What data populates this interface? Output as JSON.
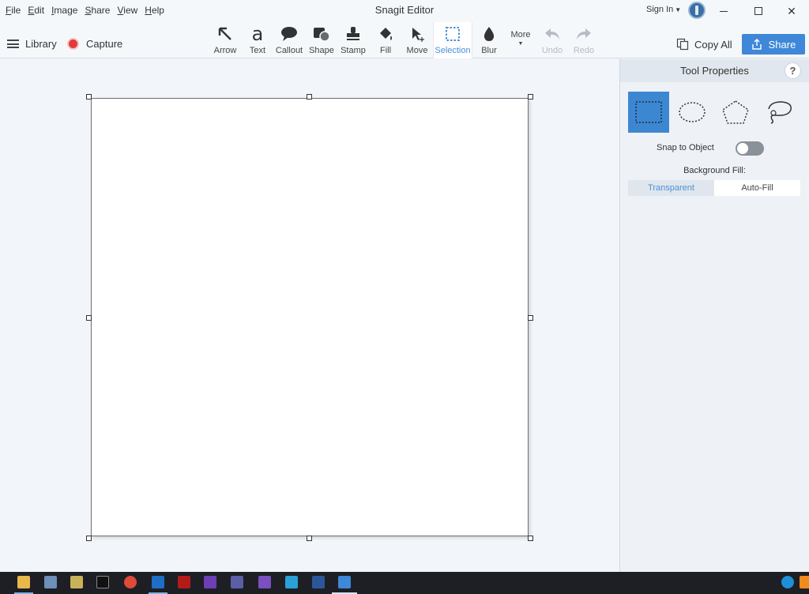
{
  "window": {
    "title": "Snagit Editor",
    "menu": [
      {
        "label": "File",
        "accel": "F",
        "rest": "ile"
      },
      {
        "label": "Edit",
        "accel": "E",
        "rest": "dit"
      },
      {
        "label": "Image",
        "accel": "I",
        "rest": "mage"
      },
      {
        "label": "Share",
        "accel": "S",
        "rest": "hare"
      },
      {
        "label": "View",
        "accel": "V",
        "rest": "iew"
      },
      {
        "label": "Help",
        "accel": "H",
        "rest": "elp"
      }
    ],
    "sign_in": "Sign In"
  },
  "toolbar": {
    "library": "Library",
    "capture": "Capture",
    "tools": [
      {
        "label": "Arrow",
        "icon": "arrow-icon"
      },
      {
        "label": "Text",
        "icon": "text-icon"
      },
      {
        "label": "Callout",
        "icon": "callout-icon"
      },
      {
        "label": "Shape",
        "icon": "shape-icon"
      },
      {
        "label": "Stamp",
        "icon": "stamp-icon"
      },
      {
        "label": "Fill",
        "icon": "fill-icon"
      },
      {
        "label": "Move",
        "icon": "move-icon"
      },
      {
        "label": "Selection",
        "icon": "selection-icon",
        "selected": true
      },
      {
        "label": "Blur",
        "icon": "blur-icon"
      },
      {
        "label": "More",
        "icon": "more-icon"
      },
      {
        "label": "Undo",
        "icon": "undo-icon",
        "disabled": true
      },
      {
        "label": "Redo",
        "icon": "redo-icon",
        "disabled": true
      }
    ],
    "copy_all": "Copy All",
    "share": "Share",
    "accent": "#3f87d8"
  },
  "panel": {
    "title": "Tool Properties",
    "help": "?",
    "selection_shapes": [
      "rectangle-selection-icon",
      "ellipse-selection-icon",
      "polygon-selection-icon",
      "freehand-selection-icon"
    ],
    "snap_to_object": "Snap to Object",
    "snap_on": false,
    "background_fill": "Background Fill:",
    "fill_options": [
      "Transparent",
      "Auto-Fill"
    ],
    "fill_selected": "Transparent"
  }
}
